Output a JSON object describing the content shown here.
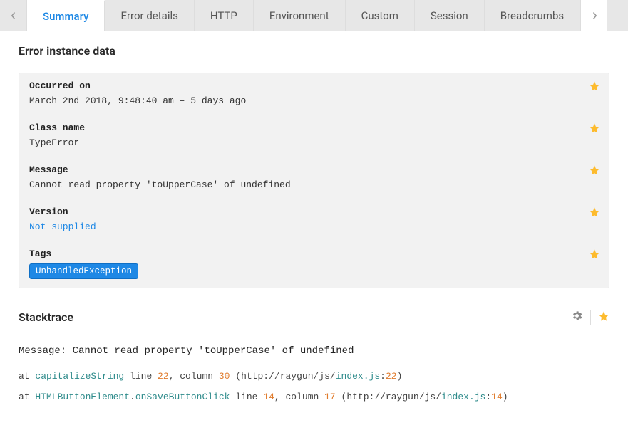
{
  "tabs": {
    "items": [
      {
        "label": "Summary",
        "active": true
      },
      {
        "label": "Error details"
      },
      {
        "label": "HTTP"
      },
      {
        "label": "Environment"
      },
      {
        "label": "Custom"
      },
      {
        "label": "Session"
      },
      {
        "label": "Breadcrumbs"
      }
    ]
  },
  "sections": {
    "instance": {
      "title": "Error instance data",
      "rows": {
        "occurred_on": {
          "label": "Occurred on",
          "value": "March 2nd 2018, 9:48:40 am – 5 days ago"
        },
        "class_name": {
          "label": "Class name",
          "value": "TypeError"
        },
        "message": {
          "label": "Message",
          "value": "Cannot read property 'toUpperCase' of undefined"
        },
        "version": {
          "label": "Version",
          "value": "Not supplied",
          "is_link": true
        },
        "tags": {
          "label": "Tags",
          "value": "UnhandledException",
          "is_tag": true
        }
      }
    },
    "stacktrace": {
      "title": "Stacktrace",
      "message_prefix": "Message: ",
      "message": "Cannot read property 'toUpperCase' of undefined",
      "frames": [
        {
          "at": "at ",
          "fn": "capitalizeString",
          "line_kw": " line ",
          "line": "22",
          "col_kw": ", column ",
          "col": "30",
          "open": " (http://raygun/js/",
          "file": "index.js",
          "sep": ":",
          "fline": "22",
          "close": ")"
        },
        {
          "at": "at ",
          "fn": "HTMLButtonElement",
          "dot": ".",
          "fn2": "onSaveButtonClick",
          "line_kw": " line ",
          "line": "14",
          "col_kw": ", column ",
          "col": "17",
          "open": " (http://raygun/js/",
          "file": "index.js",
          "sep": ":",
          "fline": "14",
          "close": ")"
        }
      ]
    }
  }
}
